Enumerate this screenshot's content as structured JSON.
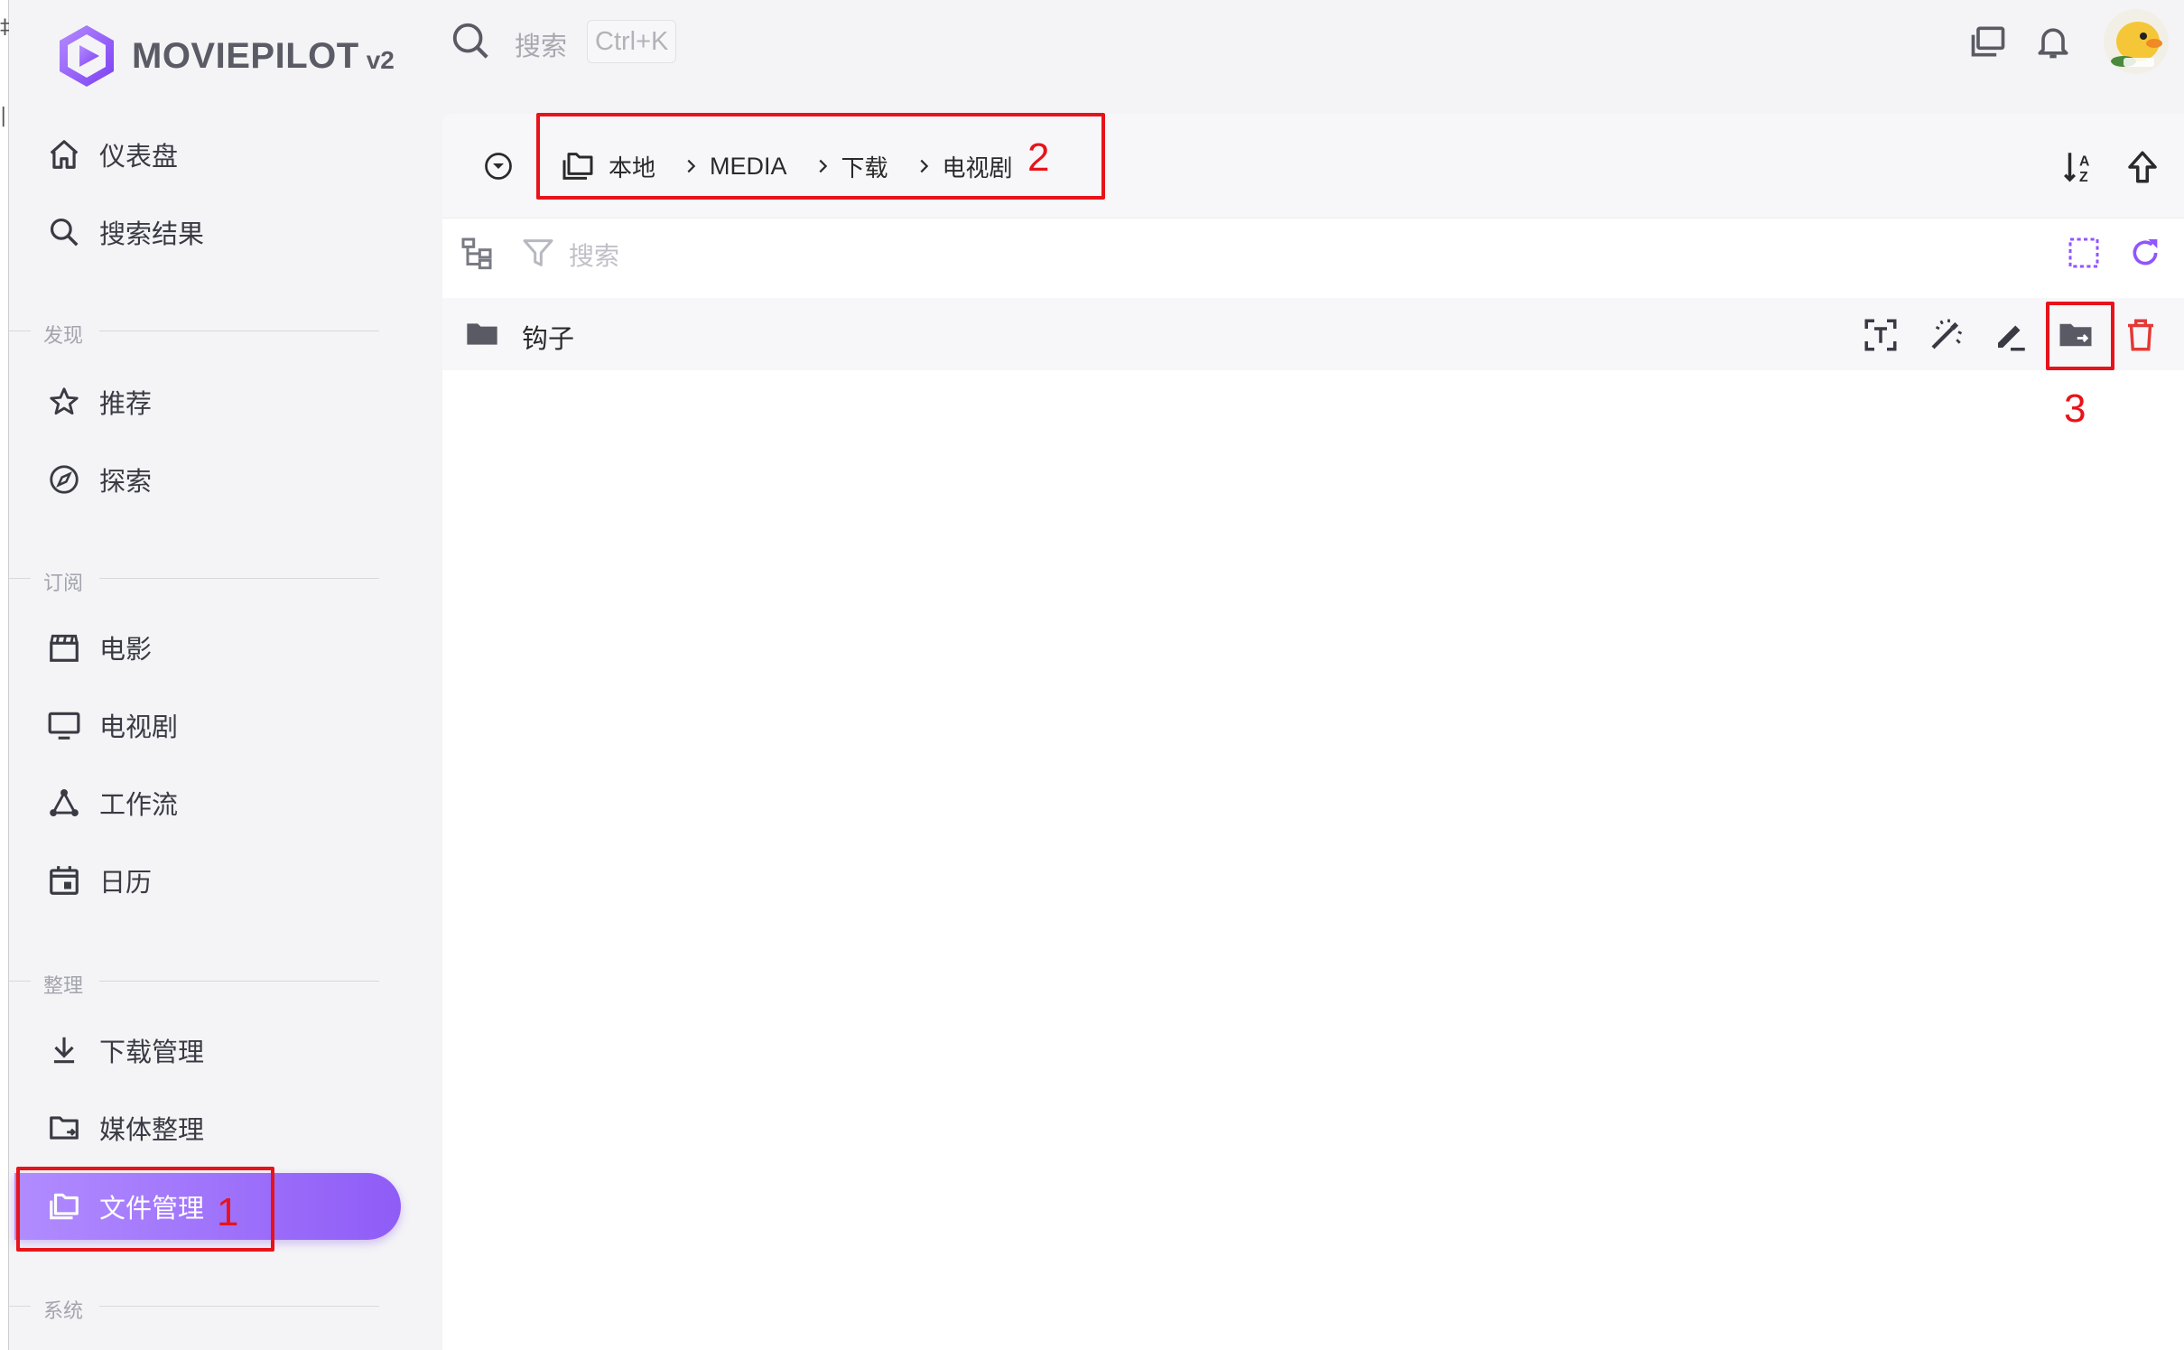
{
  "app": {
    "name": "MOVIEPILOT",
    "version": "v2"
  },
  "topbar": {
    "search_placeholder": "搜索",
    "shortcut": "Ctrl+K"
  },
  "sidebar": {
    "items": [
      {
        "label": "仪表盘",
        "icon": "home-icon"
      },
      {
        "label": "搜索结果",
        "icon": "search-icon"
      },
      {
        "label": "推荐",
        "icon": "star-icon"
      },
      {
        "label": "探索",
        "icon": "compass-icon"
      },
      {
        "label": "电影",
        "icon": "movie-clapper-icon"
      },
      {
        "label": "电视剧",
        "icon": "tv-icon"
      },
      {
        "label": "工作流",
        "icon": "workflow-icon"
      },
      {
        "label": "日历",
        "icon": "calendar-icon"
      },
      {
        "label": "下载管理",
        "icon": "download-icon"
      },
      {
        "label": "媒体整理",
        "icon": "folder-move-icon"
      },
      {
        "label": "文件管理",
        "icon": "folders-icon",
        "active": true
      }
    ],
    "sections": [
      "发现",
      "订阅",
      "整理",
      "系统"
    ]
  },
  "breadcrumb": [
    "本地",
    "MEDIA",
    "下载",
    "电视剧"
  ],
  "filter": {
    "search_placeholder": "搜索"
  },
  "files": [
    {
      "name": "钩子",
      "type": "folder"
    }
  ],
  "annotations": [
    "1",
    "2",
    "3"
  ],
  "colors": {
    "accent": "#9155fd",
    "danger": "#e53935",
    "marker": "#e8131a"
  }
}
